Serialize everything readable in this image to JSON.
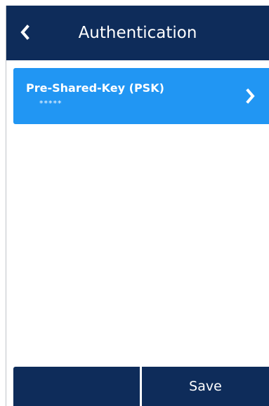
{
  "header": {
    "title": "Authentication",
    "back_icon": "chevron-left-icon"
  },
  "auth_item": {
    "label": "Pre-Shared-Key (PSK)",
    "value": "*****",
    "chevron_icon": "chevron-right-icon"
  },
  "footer": {
    "left_label": "",
    "save_label": "Save"
  },
  "colors": {
    "header_bg": "#0e2c5a",
    "item_bg": "#2196f3",
    "text": "#ffffff"
  }
}
